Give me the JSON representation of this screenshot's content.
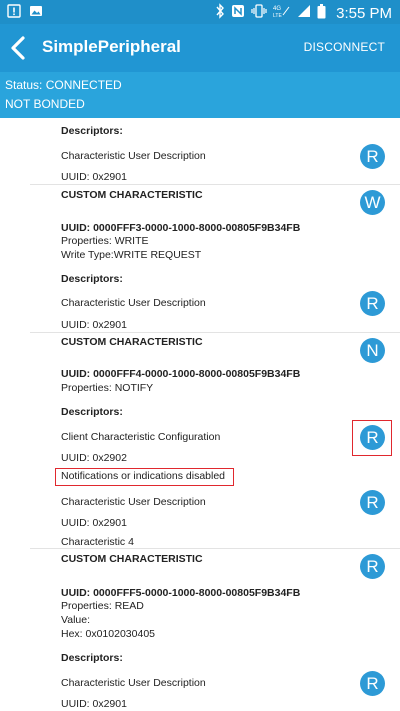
{
  "status_bar": {
    "time": "3:55 PM"
  },
  "app_bar": {
    "title": "SimplePeripheral",
    "disconnect_label": "DISCONNECT"
  },
  "connection": {
    "status": "Status: CONNECTED",
    "bond": "NOT BONDED"
  },
  "list": {
    "row1": {
      "descriptors": "Descriptors:",
      "desc_name": "Characteristic User Description",
      "desc_uuid": "UUID: 0x2901",
      "btn": "R"
    },
    "char_fff3": {
      "title": "CUSTOM CHARACTERISTIC",
      "btn": "W",
      "uuid": "UUID: 0000FFF3-0000-1000-8000-00805F9B34FB",
      "properties": "Properties: WRITE",
      "write_type": "Write Type:WRITE REQUEST",
      "descriptors": "Descriptors:",
      "desc_name": "Characteristic User Description",
      "desc_uuid": "UUID: 0x2901",
      "desc_btn": "R"
    },
    "char_fff4": {
      "title": "CUSTOM CHARACTERISTIC",
      "btn": "N",
      "uuid": "UUID: 0000FFF4-0000-1000-8000-00805F9B34FB",
      "properties": "Properties: NOTIFY",
      "descriptors": "Descriptors:",
      "cccd_name": "Client Characteristic Configuration",
      "cccd_btn": "R",
      "cccd_uuid": "UUID: 0x2902",
      "cccd_status": "Notifications or indications disabled",
      "user_desc_name": "Characteristic User Description",
      "user_desc_btn": "R",
      "user_desc_uuid": "UUID: 0x2901",
      "user_desc_value": "Characteristic 4"
    },
    "char_fff5": {
      "title": "CUSTOM CHARACTERISTIC",
      "btn": "R",
      "uuid": "UUID: 0000FFF5-0000-1000-8000-00805F9B34FB",
      "properties": "Properties: READ",
      "value_label": "Value:",
      "hex": "Hex: 0x0102030405",
      "descriptors": "Descriptors:",
      "desc_name": "Characteristic User Description",
      "desc_btn": "R",
      "desc_uuid": "UUID: 0x2901"
    }
  }
}
